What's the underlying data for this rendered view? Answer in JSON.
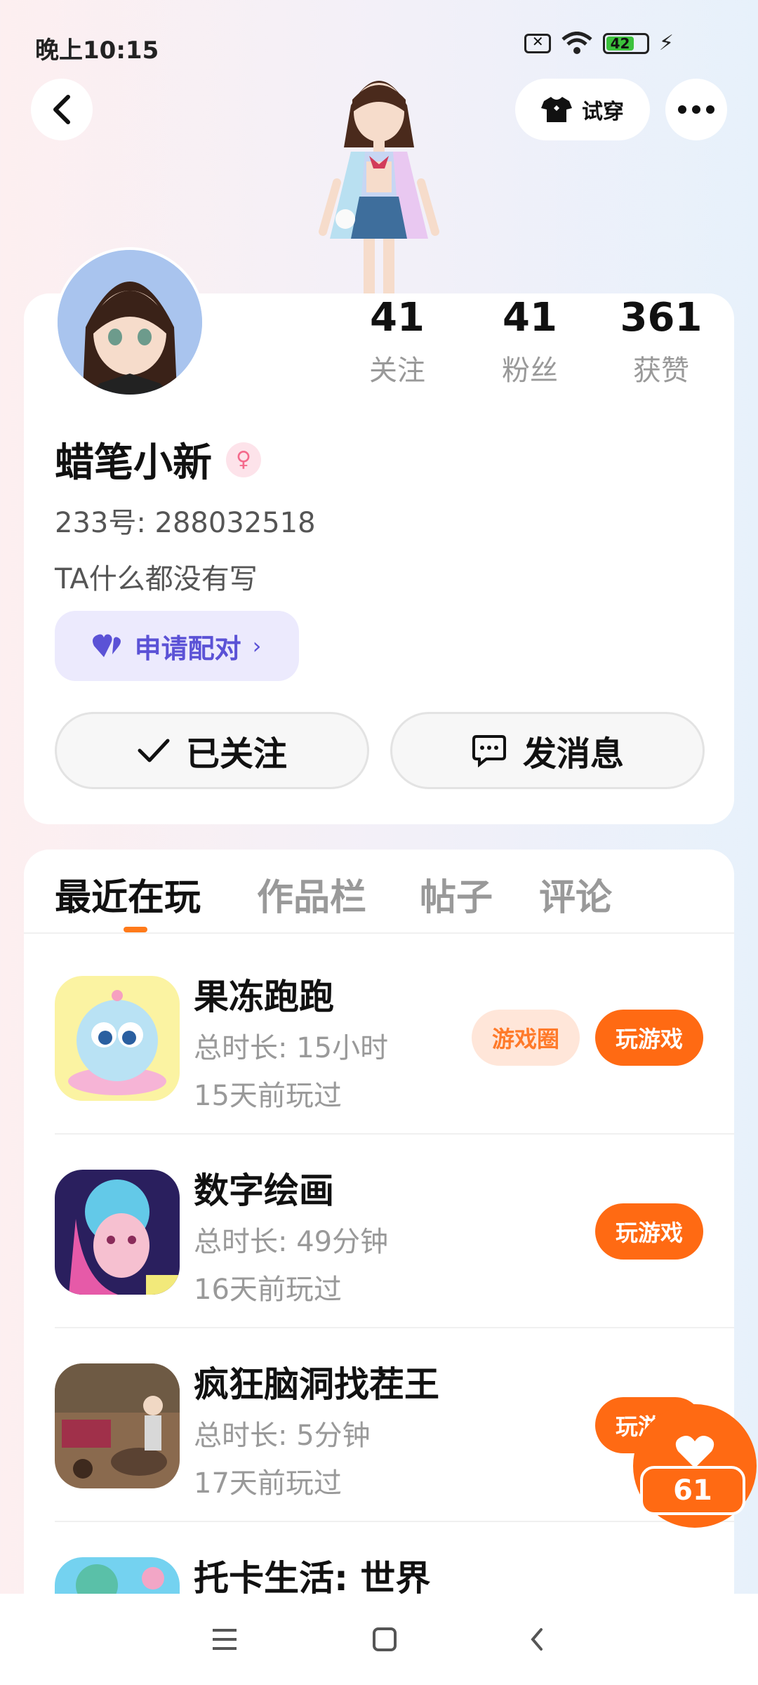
{
  "status_bar": {
    "time": "晚上10:15",
    "battery": "42"
  },
  "header": {
    "try_on_label": "试穿"
  },
  "stats": [
    {
      "value": "41",
      "label": "关注"
    },
    {
      "value": "41",
      "label": "粉丝"
    },
    {
      "value": "361",
      "label": "获赞"
    }
  ],
  "profile": {
    "name": "蜡笔小新",
    "gender": "female",
    "id_text": "233号: 288032518",
    "bio": "TA什么都没有写",
    "pair_label": "申请配对"
  },
  "actions": {
    "follow_label": "已关注",
    "message_label": "发消息"
  },
  "tabs": [
    "最近在玩",
    "作品栏",
    "帖子",
    "评论"
  ],
  "games": [
    {
      "title": "果冻跑跑",
      "duration": "总时长: 15小时",
      "last_played": "15天前玩过",
      "circle_label": "游戏圈",
      "play_label": "玩游戏"
    },
    {
      "title": "数字绘画",
      "duration": "总时长: 49分钟",
      "last_played": "16天前玩过",
      "play_label": "玩游戏"
    },
    {
      "title": "疯狂脑洞找茬王",
      "duration": "总时长: 5分钟",
      "last_played": "17天前玩过",
      "play_label": "玩游戏"
    },
    {
      "title": "托卡生活: 世界"
    }
  ],
  "like_fab": {
    "count": "61"
  },
  "colors": {
    "accent": "#ff6a13",
    "pair": "#5b52d6",
    "gender": "#f46a8c"
  }
}
